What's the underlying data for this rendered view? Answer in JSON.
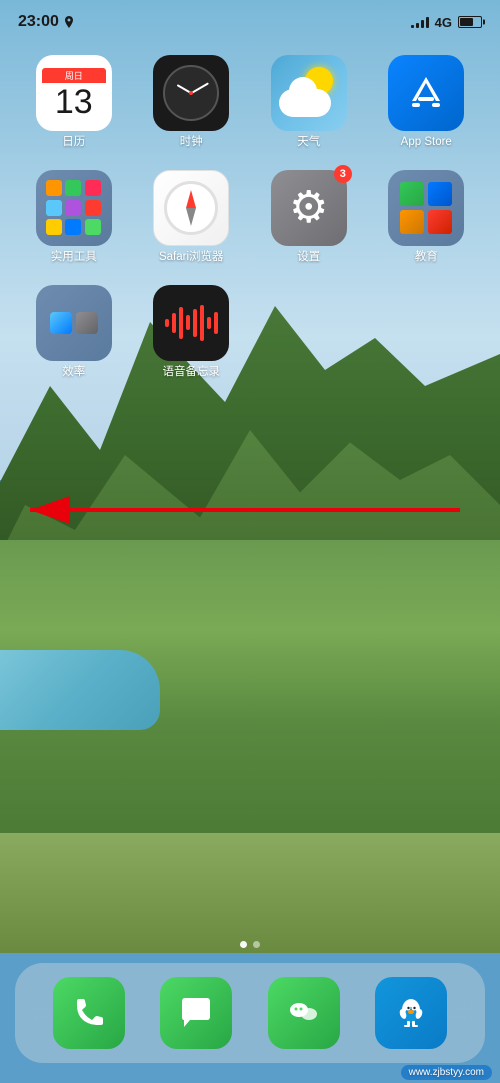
{
  "status_bar": {
    "time": "23:00",
    "network": "4G",
    "location_icon": "location-arrow"
  },
  "apps_row1": [
    {
      "id": "calendar",
      "label": "日历",
      "day": "13",
      "weekday": "周日"
    },
    {
      "id": "clock",
      "label": "时钟"
    },
    {
      "id": "weather",
      "label": "天气"
    },
    {
      "id": "appstore",
      "label": "App Store"
    }
  ],
  "apps_row2": [
    {
      "id": "utilities",
      "label": "实用工具"
    },
    {
      "id": "safari",
      "label": "Safari浏览器"
    },
    {
      "id": "settings",
      "label": "设置",
      "badge": "3"
    },
    {
      "id": "education",
      "label": "教育"
    }
  ],
  "apps_row3": [
    {
      "id": "efficiency",
      "label": "效率"
    },
    {
      "id": "voicememo",
      "label": "语音备忘录"
    }
  ],
  "dock": [
    {
      "id": "phone",
      "label": "电话"
    },
    {
      "id": "messages",
      "label": "信息"
    },
    {
      "id": "wechat",
      "label": "微信"
    },
    {
      "id": "qq",
      "label": "QQ"
    }
  ],
  "watermark": "www.zjbstyy.com",
  "arrow": {
    "direction": "left",
    "color": "#e8000a"
  }
}
